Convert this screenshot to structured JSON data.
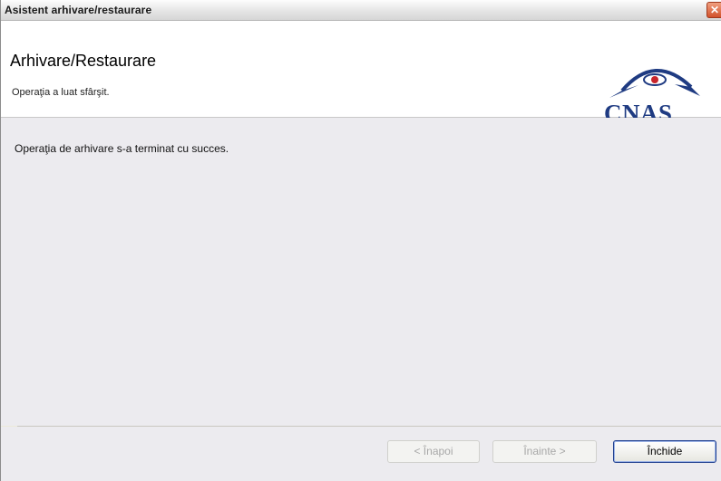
{
  "window": {
    "title": "Asistent arhivare/restaurare",
    "close_glyph": "✕"
  },
  "header": {
    "heading": "Arhivare/Restaurare",
    "subheading": "Operaţia a luat sfârşit.",
    "logo_text": "CNAS",
    "logo_icon": "cnas-logo-icon"
  },
  "main": {
    "message": "Operaţia de arhivare s-a terminat cu succes."
  },
  "buttons": {
    "back_label": "< Înapoi",
    "next_label": "Înainte >",
    "close_label": "Închide"
  },
  "colors": {
    "logo_blue": "#1f3b82",
    "logo_red": "#c8252c"
  }
}
